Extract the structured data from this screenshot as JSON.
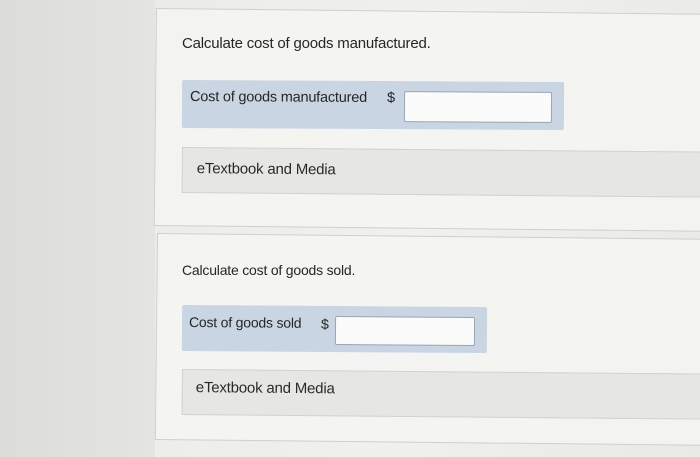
{
  "question_1": {
    "prompt": "Calculate cost of goods manufactured.",
    "field_label": "Cost of goods manufactured",
    "currency_symbol": "$",
    "input_value": "",
    "media_link": "eTextbook and Media"
  },
  "question_2": {
    "prompt": "Calculate cost of goods sold.",
    "field_label": "Cost of goods sold",
    "currency_symbol": "$",
    "input_value": "",
    "media_link": "eTextbook and Media"
  },
  "colors": {
    "answer_row_bg": "#c9d5e3",
    "page_bg": "#ededeb",
    "media_bar_bg": "#e6e6e3"
  }
}
